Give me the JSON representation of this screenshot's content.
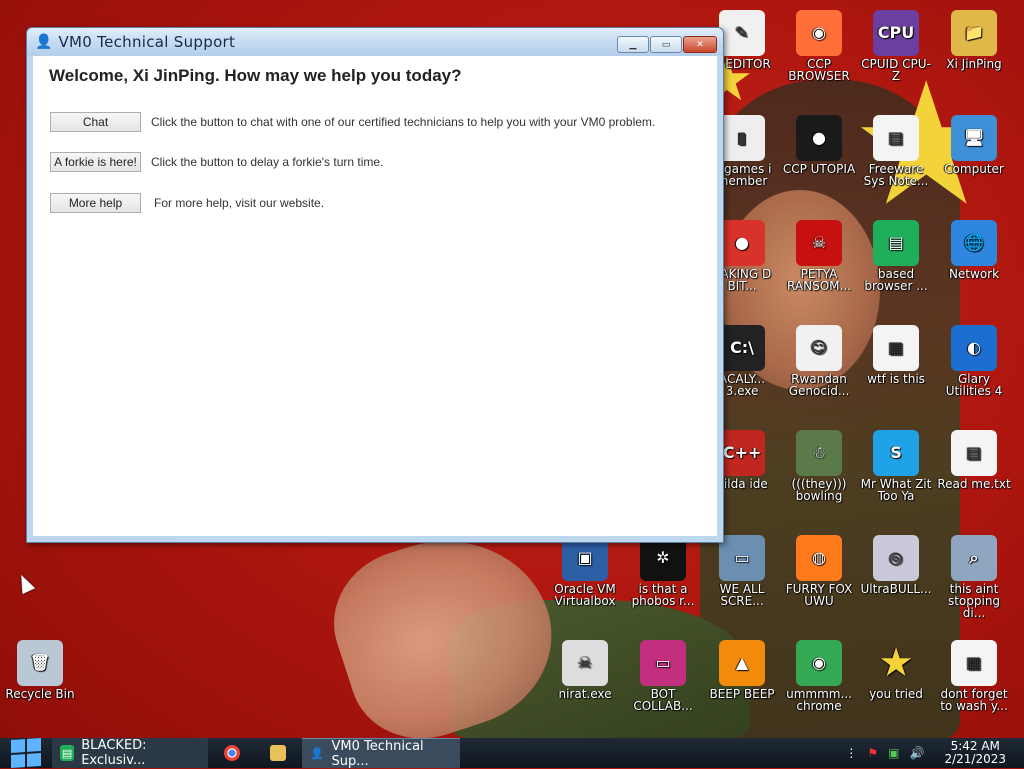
{
  "window": {
    "title": "VM0 Technical Support",
    "welcome": "Welcome, Xi JinPing. How may we help you today?",
    "rows": [
      {
        "button": "Chat",
        "description": "Click the button to chat with one of our certified technicians to help you with your VM0 problem."
      },
      {
        "button": "A forkie is here!",
        "description": "Click the button to delay a forkie's turn time."
      },
      {
        "button": "More help",
        "description": "For more help, visit our website."
      }
    ]
  },
  "desktop_icons": [
    {
      "label": "X EDITOR",
      "icon": "editor-icon",
      "color": "#f0f0f0"
    },
    {
      "label": "CCP BROWSER",
      "icon": "browser-icon",
      "color": "#ff6f3a"
    },
    {
      "label": "CPUID CPU-Z",
      "icon": "cpuz-icon",
      "color": "#6b3fa0"
    },
    {
      "label": "Xi JinPing",
      "icon": "user-folder-icon",
      "color": "#e0b84a"
    },
    {
      "label": "h games i member",
      "icon": "games-icon",
      "color": "#eee"
    },
    {
      "label": "CCP UTOPIA",
      "icon": "utopia-icon",
      "color": "#1a1a1a"
    },
    {
      "label": "Freeware Sys Note...",
      "icon": "document-icon",
      "color": "#f4f4f4"
    },
    {
      "label": "Computer",
      "icon": "computer-icon",
      "color": "#3d8fd6"
    },
    {
      "label": "EAKING D BIT...",
      "icon": "angry-bird-icon",
      "color": "#d8322b"
    },
    {
      "label": "PETYA RANSOM...",
      "icon": "skull-icon",
      "color": "#c81010"
    },
    {
      "label": "based browser ...",
      "icon": "chat-icon",
      "color": "#1fae5a"
    },
    {
      "label": "Network",
      "icon": "network-icon",
      "color": "#2e86de"
    },
    {
      "label": "ACALY... 3.exe",
      "icon": "terminal-icon",
      "color": "#222"
    },
    {
      "label": "Rwandan Genocid...",
      "icon": "meme-icon",
      "color": "#f1f1f1"
    },
    {
      "label": "wtf is this",
      "icon": "calendar-doc-icon",
      "color": "#f4f4f4"
    },
    {
      "label": "Glary Utilities 4",
      "icon": "glary-icon",
      "color": "#1c6fd1"
    },
    {
      "label": "hilda ide",
      "icon": "devcpp-icon",
      "color": "#c0281f"
    },
    {
      "label": "(((they))) bowling",
      "icon": "wizard-icon",
      "color": "#5a7a4a"
    },
    {
      "label": "Mr What Zit Too Ya",
      "icon": "skype-icon",
      "color": "#1fa3e6"
    },
    {
      "label": "Read me.txt",
      "icon": "text-file-icon",
      "color": "#f4f4f4"
    },
    {
      "label": "Oracle VM Virtualbox",
      "icon": "virtualbox-icon",
      "color": "#2d5fa6"
    },
    {
      "label": "is that a phobos r...",
      "icon": "bug-icon",
      "color": "#111"
    },
    {
      "label": "WE ALL SCRE...",
      "icon": "monitor-icon",
      "color": "#6a8fb0"
    },
    {
      "label": "FURRY FOX UWU",
      "icon": "firefox-icon",
      "color": "#ff7a1a"
    },
    {
      "label": "UltraBULL...",
      "icon": "disc-icon",
      "color": "#c9c9d9"
    },
    {
      "label": "this aint stopping di...",
      "icon": "computer-search-icon",
      "color": "#8fa6c0"
    },
    {
      "label": "Recycle Bin",
      "icon": "recycle-bin-icon",
      "color": "#b9c7d6"
    },
    {
      "label": "nirat.exe",
      "icon": "skull-app-icon",
      "color": "#ddd"
    },
    {
      "label": "BOT COLLAB...",
      "icon": "display-icon",
      "color": "#c22f7f"
    },
    {
      "label": "BEEP BEEP",
      "icon": "vlc-icon",
      "color": "#f28b0c"
    },
    {
      "label": "ummmm... chrome",
      "icon": "chrome-icon",
      "color": "#34a853"
    },
    {
      "label": "you tried",
      "icon": "star-icon",
      "color": "#f3d23a"
    },
    {
      "label": "dont forget to wash y...",
      "icon": "calendar-doc-icon",
      "color": "#f4f4f4"
    }
  ],
  "taskbar": {
    "tasks": [
      {
        "label": "BLACKED: Exclusiv...",
        "icon": "chat-icon"
      },
      {
        "label": "",
        "icon": "chrome-icon"
      },
      {
        "label": "",
        "icon": "folder-icon"
      },
      {
        "label": "VM0 Technical Sup...",
        "icon": "support-icon"
      }
    ],
    "time": "5:42 AM",
    "date": "2/21/2023"
  }
}
